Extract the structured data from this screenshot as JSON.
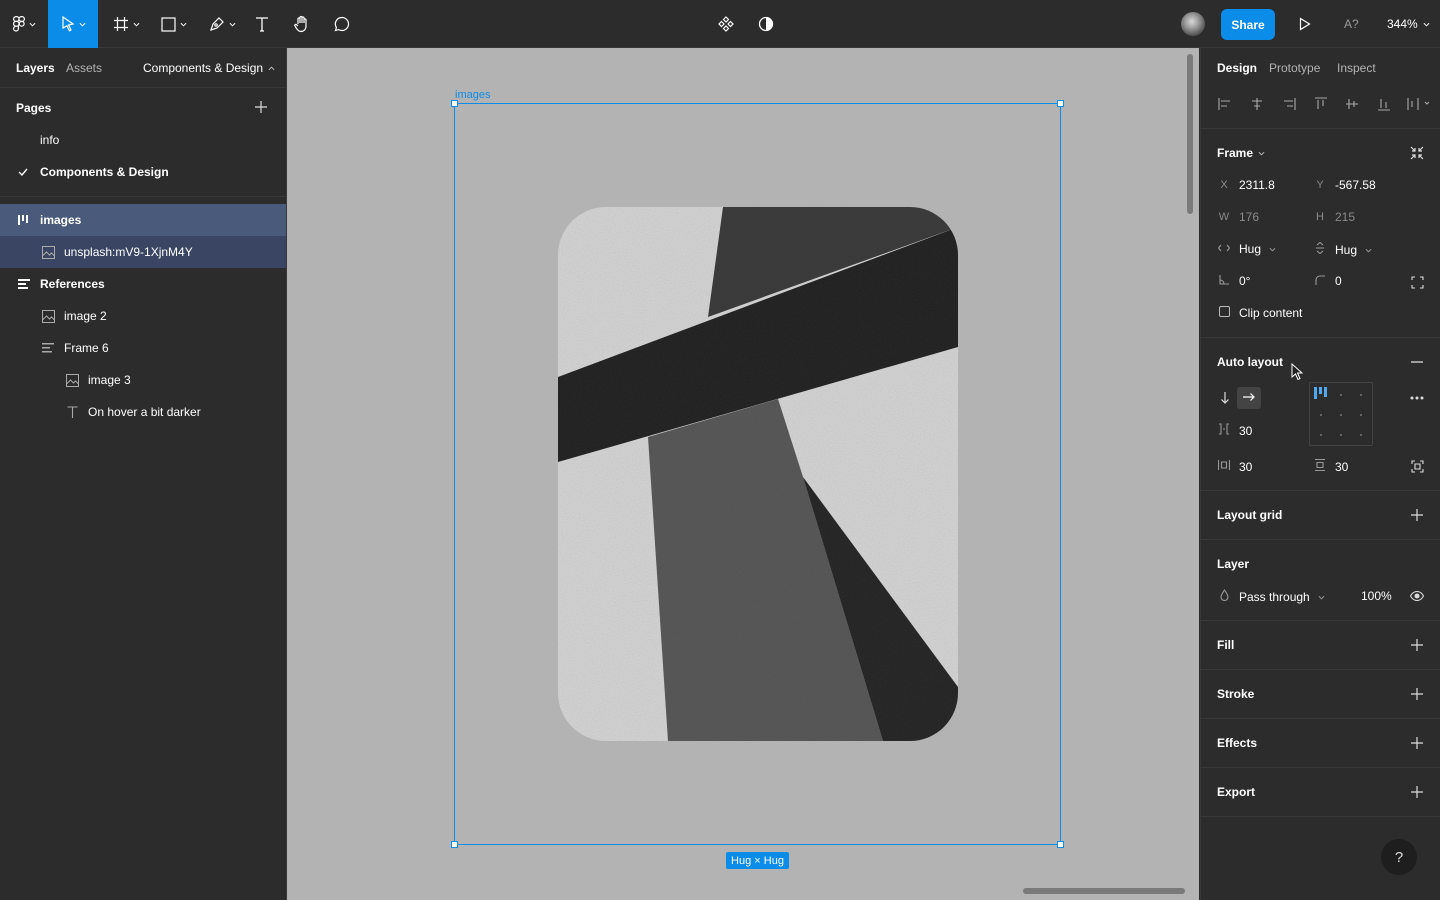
{
  "toolbar": {
    "share_label": "Share",
    "accessibility_label": "A?",
    "zoom": "344%"
  },
  "left_panel": {
    "tabs": {
      "layers": "Layers",
      "assets": "Assets",
      "page_switch": "Components & Design"
    },
    "pages_title": "Pages",
    "pages": [
      {
        "name": "info"
      },
      {
        "name": "Components & Design"
      }
    ],
    "layers": [
      {
        "name": "images"
      },
      {
        "name": "unsplash:mV9-1XjnM4Y"
      },
      {
        "name": "References"
      },
      {
        "name": "image 2"
      },
      {
        "name": "Frame 6"
      },
      {
        "name": "image 3"
      },
      {
        "name": "On hover a bit darker"
      }
    ]
  },
  "canvas": {
    "frame_name": "images",
    "size_badge": "Hug × Hug"
  },
  "right_panel": {
    "tabs": {
      "design": "Design",
      "prototype": "Prototype",
      "inspect": "Inspect"
    },
    "frame": {
      "title": "Frame",
      "x_label": "X",
      "x": "2311.8",
      "y_label": "Y",
      "y": "-567.58",
      "w_label": "W",
      "w": "176",
      "h_label": "H",
      "h": "215",
      "hresize": "Hug",
      "vresize": "Hug",
      "rotation": "0°",
      "radius": "0",
      "clip_content": "Clip content"
    },
    "auto_layout": {
      "title": "Auto layout",
      "gap": "30",
      "padding_h": "30",
      "padding_v": "30"
    },
    "layout_grid": {
      "title": "Layout grid"
    },
    "layer": {
      "title": "Layer",
      "blend": "Pass through",
      "opacity": "100%"
    },
    "fill": {
      "title": "Fill"
    },
    "stroke": {
      "title": "Stroke"
    },
    "effects": {
      "title": "Effects"
    },
    "export": {
      "title": "Export"
    },
    "help": "?"
  },
  "colors": {
    "accent": "#0c8ce9",
    "panel": "#2c2c2c",
    "canvas": "#b3b3b3",
    "selection": "#4a5a7a"
  }
}
